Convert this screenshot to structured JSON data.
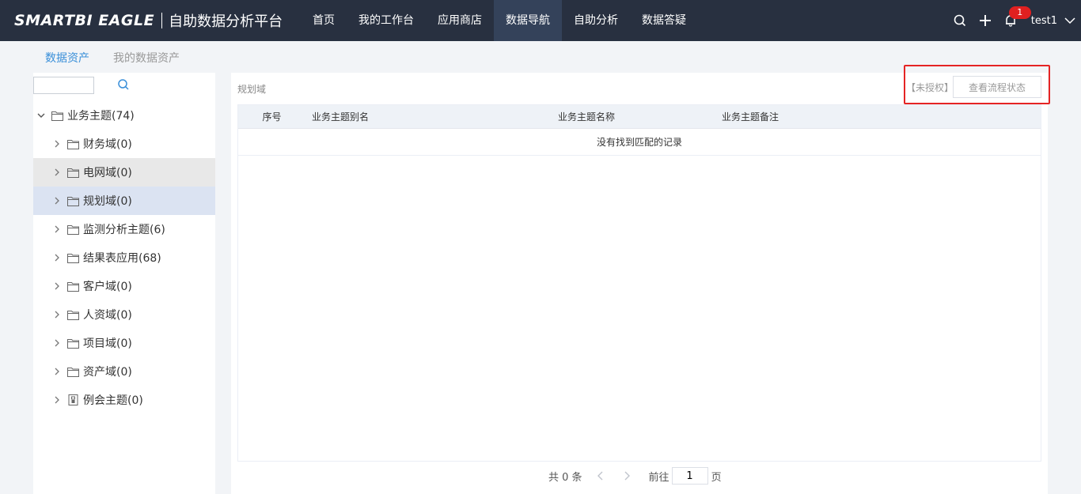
{
  "brand": {
    "logo": "SMARTBI EAGLE",
    "platform": "自助数据分析平台"
  },
  "nav": [
    {
      "label": "首页",
      "active": false
    },
    {
      "label": "我的工作台",
      "active": false
    },
    {
      "label": "应用商店",
      "active": false
    },
    {
      "label": "数据导航",
      "active": true
    },
    {
      "label": "自助分析",
      "active": false
    },
    {
      "label": "数据答疑",
      "active": false
    }
  ],
  "topbar": {
    "notification_count": "1",
    "user": "test1"
  },
  "subtabs": [
    {
      "label": "数据资产",
      "active": true
    },
    {
      "label": "我的数据资产",
      "active": false
    }
  ],
  "tree": {
    "search_value": "",
    "root": {
      "label": "业务主题(74)"
    },
    "children": [
      {
        "label": "财务域(0)",
        "icon": "folder-icon"
      },
      {
        "label": "电网域(0)",
        "icon": "folder-icon"
      },
      {
        "label": "规划域(0)",
        "icon": "folder-icon"
      },
      {
        "label": "监测分析主题(6)",
        "icon": "folder-icon"
      },
      {
        "label": "结果表应用(68)",
        "icon": "folder-icon"
      },
      {
        "label": "客户域(0)",
        "icon": "folder-icon"
      },
      {
        "label": "人资域(0)",
        "icon": "folder-icon"
      },
      {
        "label": "项目域(0)",
        "icon": "folder-icon"
      },
      {
        "label": "资产域(0)",
        "icon": "folder-icon"
      },
      {
        "label": "例会主题(0)",
        "icon": "document-icon"
      }
    ]
  },
  "panel": {
    "title": "规划域",
    "unauthorized": "【未授权】",
    "status_button": "查看流程状态",
    "columns": [
      "序号",
      "业务主题别名",
      "业务主题名称",
      "业务主题备注"
    ],
    "empty_text": "没有找到匹配的记录"
  },
  "pager": {
    "total": "共 0 条",
    "goto": "前往",
    "page": "1",
    "page_suffix": "页"
  },
  "colors": {
    "topbar": "#283040",
    "nav_active": "#34425a",
    "accent": "#3a8fd9",
    "highlight": "#e52424"
  }
}
